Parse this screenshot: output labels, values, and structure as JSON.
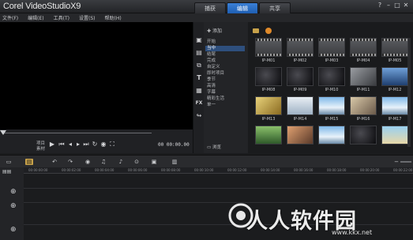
{
  "app": {
    "title": "Corel VideoStudioX9"
  },
  "tabs": [
    {
      "label": "捕获",
      "active": false
    },
    {
      "label": "编辑",
      "active": true
    },
    {
      "label": "共享",
      "active": false
    }
  ],
  "window_buttons": [
    "?",
    "–",
    "□",
    "✕"
  ],
  "menu": [
    "文件(F)",
    "编辑(E)",
    "工具(T)",
    "设置(S)",
    "帮助(H)"
  ],
  "player": {
    "mode_project": "项目",
    "mode_clip": "素材",
    "timecode": "00 00:00.00"
  },
  "library": {
    "add_label": "添加",
    "browse_label": "浏览",
    "folders": [
      {
        "label": "开始",
        "selected": false
      },
      {
        "label": "当中",
        "selected": true
      },
      {
        "label": "结尾",
        "selected": false
      },
      {
        "label": "完成",
        "selected": false
      },
      {
        "label": "自定义",
        "selected": false
      },
      {
        "label": "即时项目",
        "selected": false
      },
      {
        "label": "季节",
        "selected": false
      },
      {
        "label": "高清",
        "selected": false
      },
      {
        "label": "字幕",
        "selected": false
      },
      {
        "label": "精彩生活",
        "selected": false
      },
      {
        "label": "单一",
        "selected": false
      }
    ],
    "thumbnails": [
      {
        "label": "IP-M01",
        "style": "film"
      },
      {
        "label": "IP-M02",
        "style": "film"
      },
      {
        "label": "IP-M03",
        "style": "film"
      },
      {
        "label": "IP-M04",
        "style": "film"
      },
      {
        "label": "IP-M05",
        "style": "film"
      },
      {
        "label": "IP-M08",
        "style": "dark"
      },
      {
        "label": "IP-M09",
        "style": "dark"
      },
      {
        "label": "IP-M10",
        "style": "dark"
      },
      {
        "label": "IP-M11",
        "style": "gray"
      },
      {
        "label": "IP-M12",
        "style": "blue"
      },
      {
        "label": "IP-M13",
        "style": "yellow"
      },
      {
        "label": "IP-M14",
        "style": "bright"
      },
      {
        "label": "IP-M15",
        "style": "sky"
      },
      {
        "label": "IP-M16",
        "style": "photo"
      },
      {
        "label": "IP-M17",
        "style": "sky"
      },
      {
        "label": "",
        "style": "green"
      },
      {
        "label": "",
        "style": "warm"
      },
      {
        "label": "",
        "style": "sky"
      },
      {
        "label": "",
        "style": "dark"
      },
      {
        "label": "",
        "style": "beach"
      }
    ]
  },
  "timeline": {
    "ruler_ticks": [
      "00:00:00:00",
      "00:00:02:00",
      "00:00:04:00",
      "00:00:06:00",
      "00:00:08:00",
      "00:00:10:00",
      "00:00:12:00",
      "00:00:14:00",
      "00:00:16:00",
      "00:00:18:00",
      "00:00:20:00",
      "00:00:22:00"
    ]
  },
  "watermark": {
    "text": "人人软件园",
    "url": "www.kkx.net"
  },
  "colors": {
    "accent": "#2e6fc4",
    "background": "#1b1c1e",
    "preview": "#000000"
  }
}
